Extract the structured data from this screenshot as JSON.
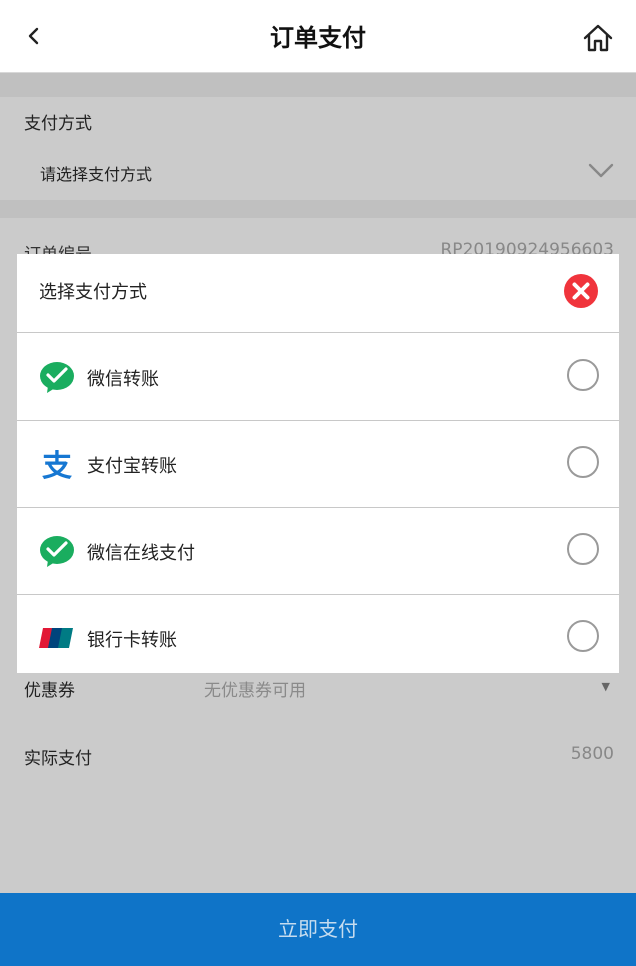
{
  "header": {
    "title": "订单支付",
    "back_icon": "chevron-left-icon",
    "home_icon": "home-icon"
  },
  "payment": {
    "label": "支付方式",
    "select_placeholder": "请选择支付方式",
    "chevron_icon": "chevron-down-icon"
  },
  "order": {
    "label": "订单编号",
    "value": "RP20190924956603"
  },
  "coupon": {
    "label": "优惠券",
    "value": "无优惠券可用",
    "caret": "▼"
  },
  "actual": {
    "label": "实际支付",
    "value": "5800"
  },
  "pay_button": "立即支付",
  "modal": {
    "title": "选择支付方式",
    "close_icon": "close-circle-icon",
    "options": [
      {
        "label": "微信转账",
        "icon": "wechat-icon",
        "selected": false
      },
      {
        "label": "支付宝转账",
        "icon": "alipay-icon",
        "selected": false
      },
      {
        "label": "微信在线支付",
        "icon": "wechat-icon",
        "selected": false
      },
      {
        "label": "银行卡转账",
        "icon": "unionpay-icon",
        "selected": false
      }
    ]
  },
  "colors": {
    "primary": "#0f74c8",
    "overlay": "#cbcbcb",
    "wechat": "#1aad5f",
    "alipay": "#1677d2",
    "close": "#f0343c"
  }
}
